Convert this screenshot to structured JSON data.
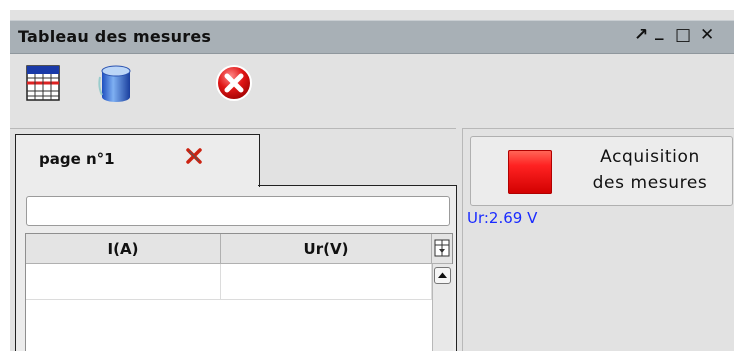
{
  "window": {
    "title": "Tableau des mesures",
    "controls": {
      "pin": "↗",
      "minimize": "_",
      "maximize": "□",
      "close": "✕"
    }
  },
  "toolbar": {
    "icons": [
      "table-grid-icon",
      "database-icon",
      "close-red-icon"
    ]
  },
  "tabs": [
    {
      "label": "page n°1",
      "close_icon": "tab-close-icon"
    }
  ],
  "search": {
    "value": "",
    "placeholder": ""
  },
  "table": {
    "columns": [
      "I(A)",
      "Ur(V)"
    ],
    "rows": [
      [
        "",
        ""
      ]
    ]
  },
  "acquisition": {
    "button_label_line1": "Acquisition",
    "button_label_line2": "des mesures",
    "indicator_color": "#ee1111"
  },
  "measurement": {
    "text": "Ur:2.69 V",
    "color": "#1a2bff"
  }
}
